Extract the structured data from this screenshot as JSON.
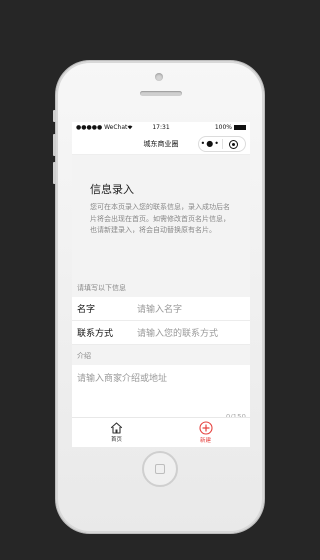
{
  "status_bar": {
    "carrier": "●●●●● WeChat",
    "wifi_icon": "wifi-icon",
    "time": "17:31",
    "battery": "100%"
  },
  "nav_bar": {
    "title": "城东商业圈",
    "more_glyph": "•●•",
    "close_icon": "circle-close-icon"
  },
  "intro": {
    "title": "信息录入",
    "text": "您可在本页录入您的联系信息，录入成功后名片将会出现在首页。如需修改首页名片信息，也请新建录入，将会自动替换原有名片。"
  },
  "form": {
    "section_label": "请填写以下信息",
    "fields": [
      {
        "label": "名字",
        "placeholder": "请输入名字"
      },
      {
        "label": "联系方式",
        "placeholder": "请输入您的联系方式"
      }
    ],
    "intro_section_label": "介绍",
    "intro_placeholder": "请输入商家介绍或地址",
    "counter": "0/150"
  },
  "tab_bar": {
    "tabs": [
      {
        "label": "首页",
        "icon": "home-icon",
        "active": false
      },
      {
        "label": "新建",
        "icon": "plus-circle-icon",
        "active": true
      }
    ],
    "active_color": "#e64340",
    "inactive_color": "#333333"
  }
}
